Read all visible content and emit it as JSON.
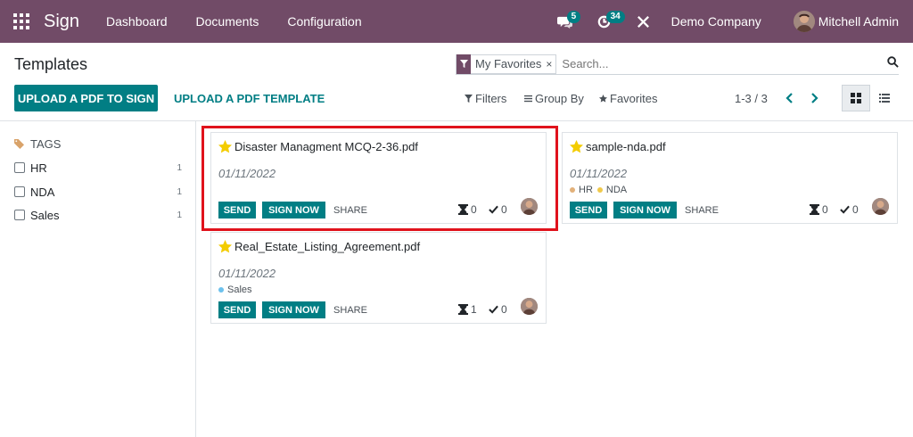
{
  "navbar": {
    "app_name": "Sign",
    "menus": [
      "Dashboard",
      "Documents",
      "Configuration"
    ],
    "messages_count": "5",
    "activities_count": "34",
    "company": "Demo Company",
    "user": "Mitchell Admin"
  },
  "control_panel": {
    "title": "Templates",
    "facet_label": "My Favorites",
    "facet_close": "×",
    "search_placeholder": "Search...",
    "upload_pdf_sign": "UPLOAD A PDF TO SIGN",
    "upload_pdf_template": "UPLOAD A PDF TEMPLATE",
    "filters": "Filters",
    "group_by": "Group By",
    "favorites": "Favorites",
    "pager": "1-3 / 3"
  },
  "sidebar": {
    "header": "TAGS",
    "tags": [
      {
        "label": "HR",
        "count": "1"
      },
      {
        "label": "NDA",
        "count": "1"
      },
      {
        "label": "Sales",
        "count": "1"
      }
    ]
  },
  "cards": [
    {
      "title": "Disaster Managment MCQ-2-36.pdf",
      "date": "01/11/2022",
      "tags": [],
      "send": "SEND",
      "sign_now": "SIGN NOW",
      "share": "SHARE",
      "pending": "0",
      "signed": "0"
    },
    {
      "title": "sample-nda.pdf",
      "date": "01/11/2022",
      "tags": [
        {
          "label": "HR",
          "color": "#e2b17a"
        },
        {
          "label": "NDA",
          "color": "#f0c94b"
        }
      ],
      "send": "SEND",
      "sign_now": "SIGN NOW",
      "share": "SHARE",
      "pending": "0",
      "signed": "0"
    },
    {
      "title": "Real_Estate_Listing_Agreement.pdf",
      "date": "01/11/2022",
      "tags": [
        {
          "label": "Sales",
          "color": "#6cc1ed"
        }
      ],
      "send": "SEND",
      "sign_now": "SIGN NOW",
      "share": "SHARE",
      "pending": "1",
      "signed": "0"
    }
  ],
  "colors": {
    "brand": "#714b67",
    "accent": "#017e84",
    "highlight": "#e0121c",
    "star": "#f3cc00"
  }
}
